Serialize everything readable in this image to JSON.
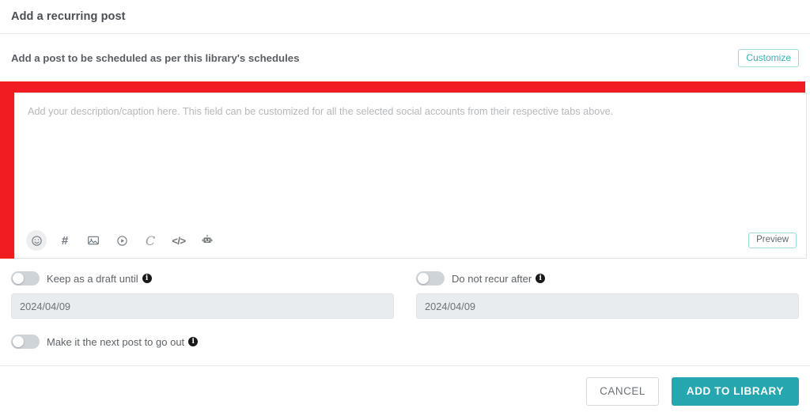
{
  "header": {
    "title": "Add a recurring post"
  },
  "subtitle": {
    "text": "Add a post to be scheduled as per this library's schedules",
    "customize_label": "Customize"
  },
  "composer": {
    "placeholder": "Add your description/caption here. This field can be customized for all the selected social accounts from their respective tabs above.",
    "value": "",
    "preview_label": "Preview",
    "toolbar": [
      {
        "name": "emoji-icon",
        "glyph": "☺",
        "active": true
      },
      {
        "name": "hashtag-icon",
        "glyph": "#",
        "active": false
      },
      {
        "name": "image-icon",
        "glyph": "🖼",
        "active": false
      },
      {
        "name": "video-icon",
        "glyph": "▶",
        "active": false
      },
      {
        "name": "cursive-c-icon",
        "glyph": "C",
        "active": false
      },
      {
        "name": "code-icon",
        "glyph": "</>",
        "active": false
      },
      {
        "name": "robot-ai-icon",
        "glyph": "🤖",
        "active": false
      }
    ]
  },
  "options": {
    "keep_draft": {
      "label": "Keep as a draft until",
      "info": "i",
      "toggle_state": "off",
      "date_value": "2024/04/09"
    },
    "do_not_recur": {
      "label": "Do not recur after",
      "info": "i",
      "toggle_state": "off",
      "date_value": "2024/04/09"
    },
    "next_post": {
      "label": "Make it the next post to go out",
      "info": "i",
      "toggle_state": "off"
    }
  },
  "footer": {
    "cancel_label": "CANCEL",
    "submit_label": "ADD TO LIBRARY"
  },
  "colors": {
    "accent_teal": "#26a6ae",
    "accent_teal_light": "#33b0b8",
    "highlight_red": "#f01c22",
    "muted_text": "#6c757d",
    "disabled_field": "#e9ecef"
  }
}
